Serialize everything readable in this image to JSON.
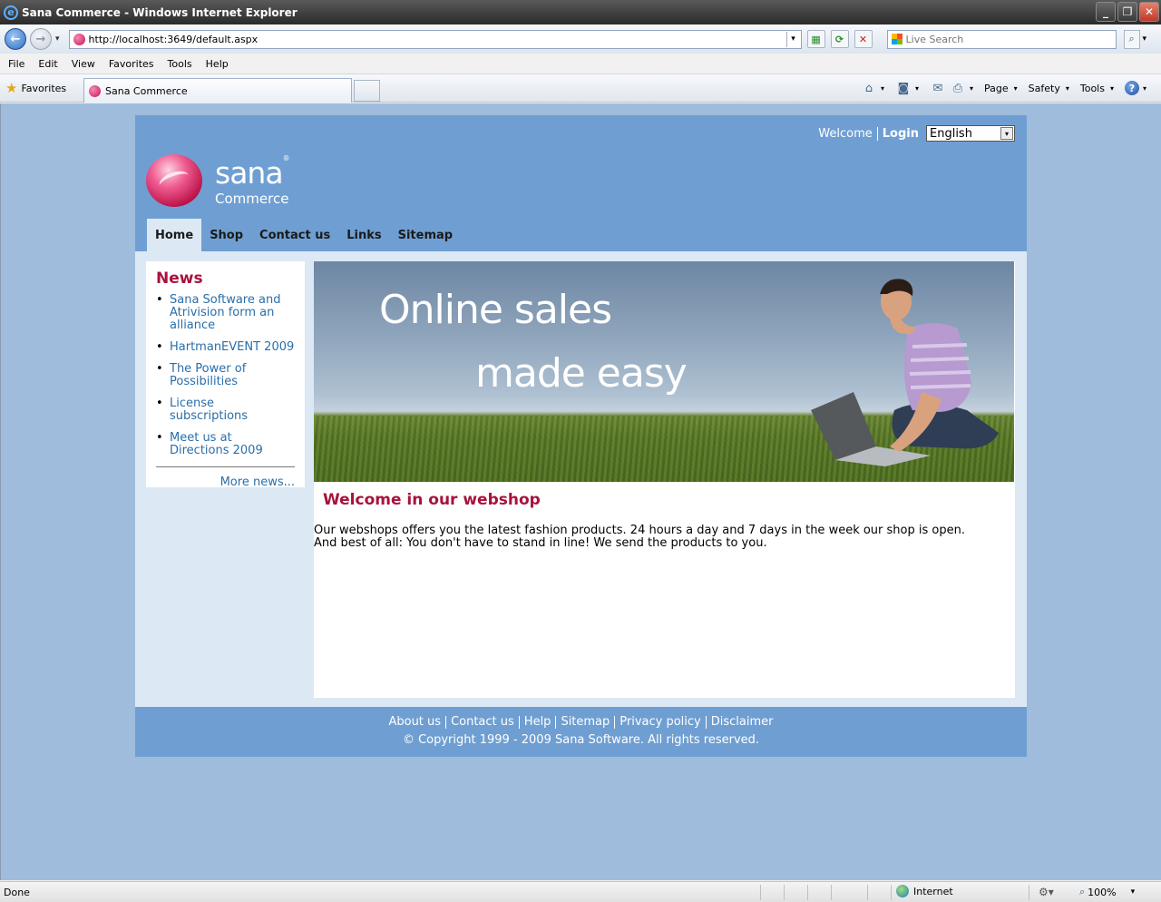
{
  "window": {
    "title": "Sana Commerce - Windows Internet Explorer",
    "minimize_glyph": "_",
    "restore_glyph": "❐",
    "close_glyph": "✕"
  },
  "addressbar": {
    "url": "http://localhost:3649/default.aspx",
    "search_placeholder": "Live Search",
    "back_glyph": "←",
    "forward_glyph": "→",
    "drop_glyph": "▾"
  },
  "menubar": {
    "items": [
      "File",
      "Edit",
      "View",
      "Favorites",
      "Tools",
      "Help"
    ]
  },
  "favbar": {
    "favorites_label": "Favorites",
    "tab_title": "Sana Commerce",
    "commands": {
      "page": "Page",
      "safety": "Safety",
      "tools": "Tools",
      "help_glyph": "?"
    }
  },
  "site": {
    "header": {
      "welcome": "Welcome",
      "login": "Login",
      "language_selected": "English",
      "logo_name": "sana",
      "logo_reg": "®",
      "logo_sub": "Commerce"
    },
    "nav": [
      "Home",
      "Shop",
      "Contact us",
      "Links",
      "Sitemap"
    ],
    "news": {
      "title": "News",
      "items": [
        "Sana Software and Atrivision form an alliance",
        "HartmanEVENT 2009",
        "The Power of Possibilities",
        "License subscriptions",
        "Meet us at Directions 2009"
      ],
      "more": "More news..."
    },
    "banner": {
      "line1": "Online sales",
      "line2": "made easy"
    },
    "content": {
      "title": "Welcome in our webshop",
      "text_line1": "Our webshops offers you the latest fashion products. 24 hours a day and 7 days in the week our shop is open.",
      "text_line2": "And best of all: You don't have to stand in line! We send the products to you."
    },
    "footer": {
      "links": [
        "About us",
        "Contact us",
        "Help",
        "Sitemap",
        "Privacy policy",
        "Disclaimer"
      ],
      "copyright": "© Copyright 1999 - 2009 Sana Software. All rights reserved."
    }
  },
  "statusbar": {
    "status": "Done",
    "zone": "Internet",
    "zoom": "100%"
  },
  "colors": {
    "brand_red": "#a8123d",
    "header_blue": "#6f9fd2",
    "page_bg": "#9fbcdc",
    "link_blue": "#2a6ea8"
  },
  "icons": {
    "ie": "ie-logo-icon",
    "favorites": "star-icon",
    "home": "home-icon",
    "feeds": "rss-icon",
    "mail": "mail-icon",
    "print": "print-icon",
    "zone": "globe-icon",
    "zoom": "magnifier-icon"
  }
}
